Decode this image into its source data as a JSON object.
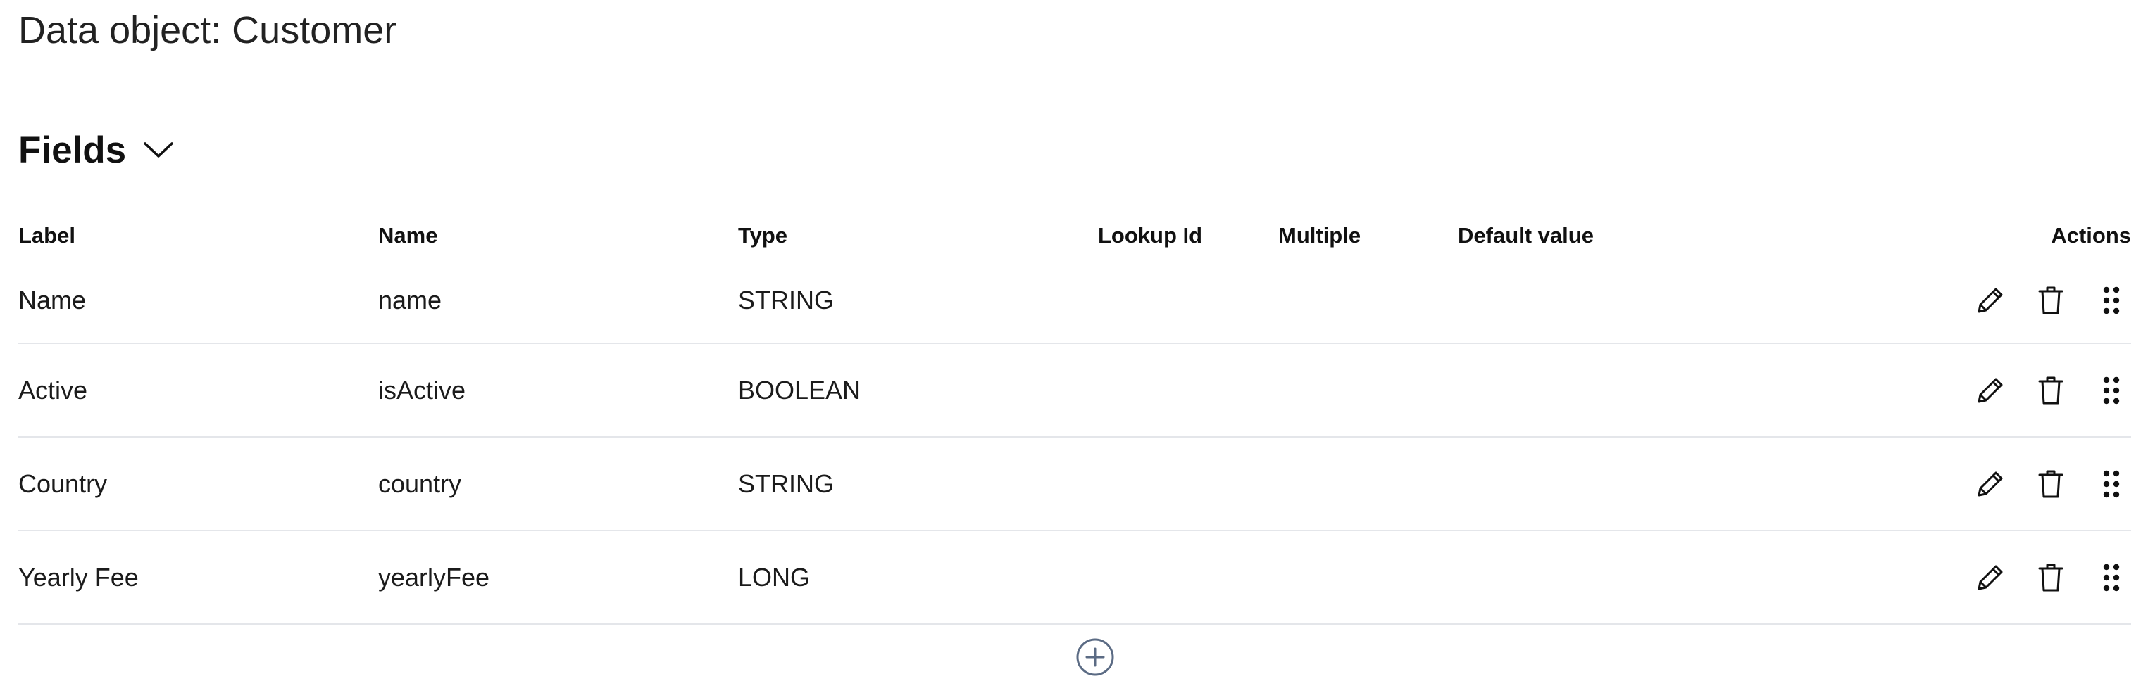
{
  "page": {
    "title": "Data object: Customer"
  },
  "section": {
    "title": "Fields",
    "chevron_icon": "chevron-down-icon"
  },
  "table": {
    "headers": {
      "label": "Label",
      "name": "Name",
      "type": "Type",
      "lookup_id": "Lookup Id",
      "multiple": "Multiple",
      "default_value": "Default value",
      "actions": "Actions"
    },
    "rows": [
      {
        "label": "Name",
        "name": "name",
        "type": "STRING",
        "lookup_id": "",
        "multiple": "",
        "default_value": ""
      },
      {
        "label": "Active",
        "name": "isActive",
        "type": "BOOLEAN",
        "lookup_id": "",
        "multiple": "",
        "default_value": ""
      },
      {
        "label": "Country",
        "name": "country",
        "type": "STRING",
        "lookup_id": "",
        "multiple": "",
        "default_value": ""
      },
      {
        "label": "Yearly Fee",
        "name": "yearlyFee",
        "type": "LONG",
        "lookup_id": "",
        "multiple": "",
        "default_value": ""
      }
    ],
    "row_action_icons": [
      "pencil-icon",
      "trash-icon",
      "drag-handle-icon"
    ]
  },
  "add_button": {
    "icon": "plus-circle-icon"
  },
  "colors": {
    "text": "#1b1b1b",
    "divider": "#e4e6ea",
    "add_icon": "#5b6b84"
  }
}
